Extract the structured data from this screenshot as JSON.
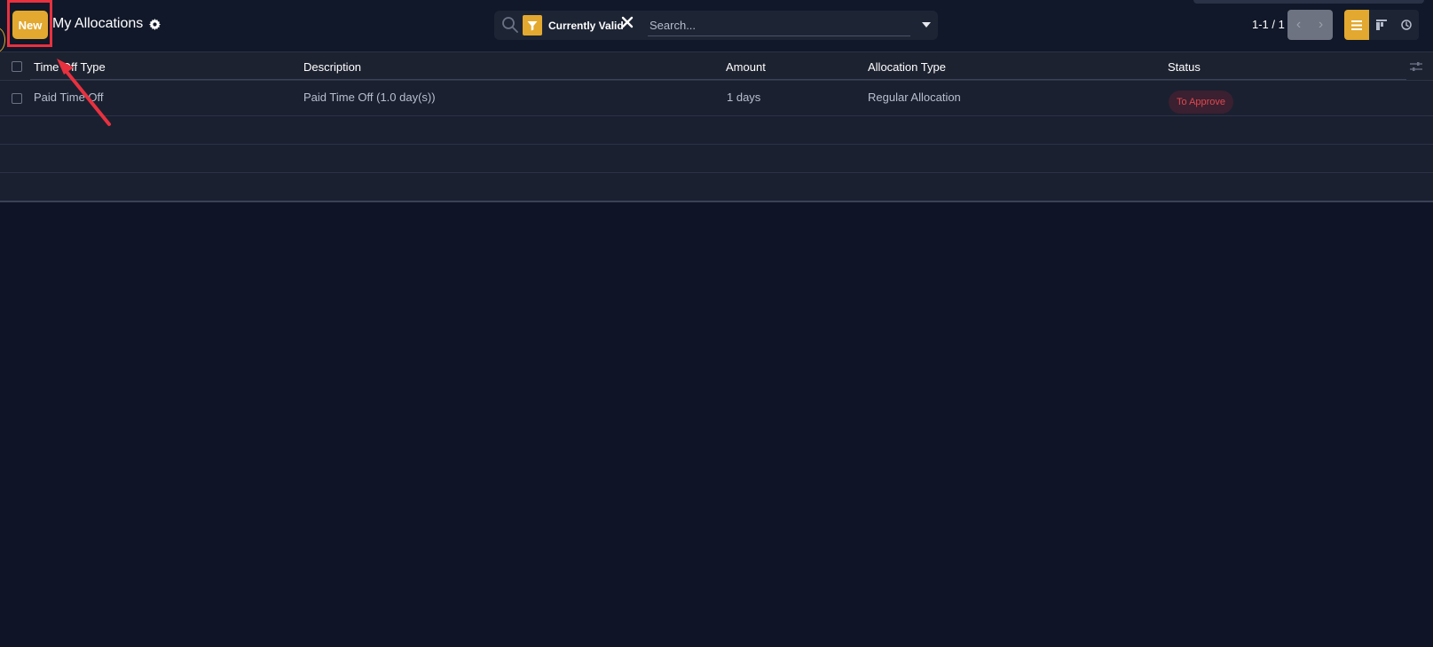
{
  "toolbar": {
    "new_label": "New",
    "page_title": "My Allocations"
  },
  "search": {
    "facet_label": "Currently Valid",
    "placeholder": "Search..."
  },
  "pager": {
    "value": "1-1 / 1",
    "prev_glyph": "‹",
    "next_glyph": "›"
  },
  "table": {
    "columns": [
      "Time Off Type",
      "Description",
      "Amount",
      "Allocation Type",
      "Status"
    ],
    "rows": [
      {
        "time_off_type": "Paid Time Off",
        "description": "Paid Time Off (1.0 day(s))",
        "amount": "1 days",
        "allocation_type": "Regular Allocation",
        "status": "To Approve"
      }
    ]
  },
  "colors": {
    "accent": "#e2a82f",
    "background": "#0f1526",
    "annotation": "#e8313f",
    "status_danger": "#e0484f"
  },
  "icons": [
    "gear-icon",
    "search-icon",
    "filter-icon",
    "close-icon",
    "caret-down-icon",
    "chevron-left-icon",
    "chevron-right-icon",
    "list-view-icon",
    "kanban-view-icon",
    "activity-view-icon",
    "optional-columns-icon"
  ]
}
